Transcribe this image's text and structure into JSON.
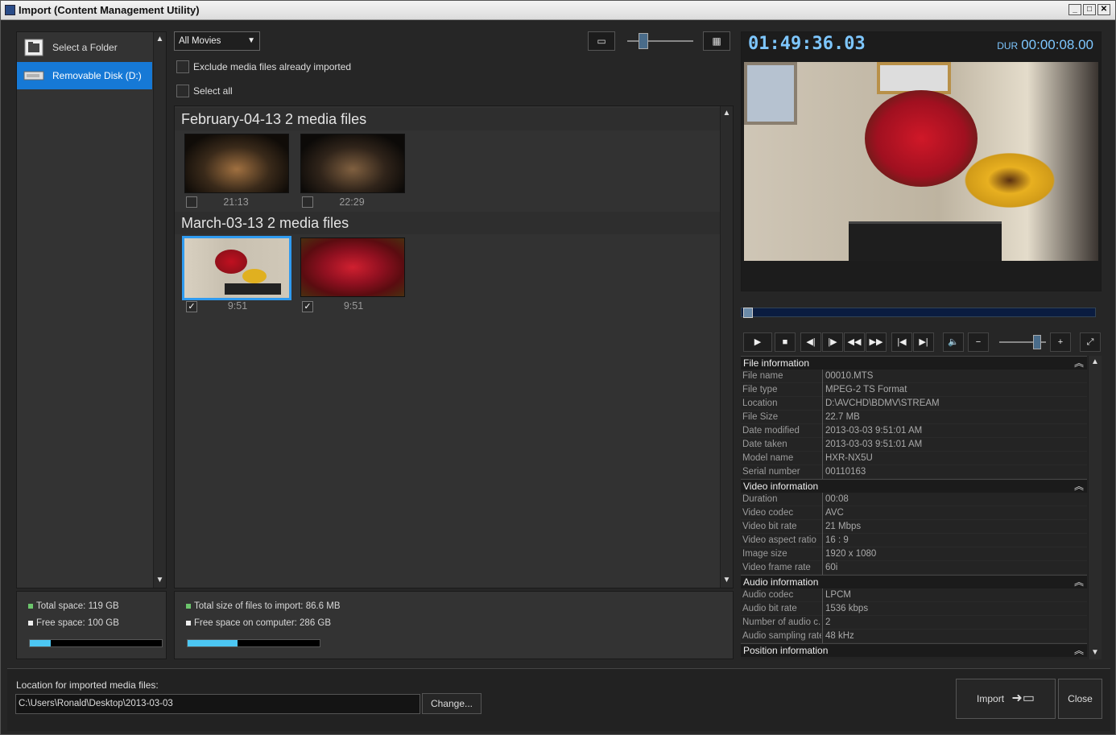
{
  "window": {
    "title": "Import (Content Management Utility)"
  },
  "sidebar": {
    "items": [
      {
        "label": "Select a Folder",
        "icon": "folder-icon"
      },
      {
        "label": "Removable Disk (D:)",
        "icon": "drive-icon"
      }
    ],
    "total_space": "Total space: 119 GB",
    "free_space": "Free space: 100 GB",
    "usage_fraction": 0.16
  },
  "browser": {
    "filter": "All Movies",
    "exclude_label": "Exclude media files already imported",
    "select_all_label": "Select all",
    "groups": [
      {
        "title": "February-04-13 2 media files",
        "items": [
          {
            "time": "21:13",
            "checked": false
          },
          {
            "time": "22:29",
            "checked": false
          }
        ]
      },
      {
        "title": "March-03-13 2 media files",
        "items": [
          {
            "time": "9:51",
            "checked": true
          },
          {
            "time": "9:51",
            "checked": true
          }
        ]
      }
    ],
    "total_import": "Total size of files to import: 86.6 MB",
    "free_computer": "Free space on computer: 286 GB",
    "usage_fraction": 0.38
  },
  "preview": {
    "timecode": "01:49:36.03",
    "dur_label": "DUR",
    "duration": "00:00:08.00"
  },
  "file_info": {
    "header": "File information",
    "rows": [
      {
        "k": "File name",
        "v": "00010.MTS"
      },
      {
        "k": "File type",
        "v": "MPEG-2 TS Format"
      },
      {
        "k": "Location",
        "v": "D:\\AVCHD\\BDMV\\STREAM"
      },
      {
        "k": "File Size",
        "v": "22.7 MB"
      },
      {
        "k": "Date modified",
        "v": "2013-03-03 9:51:01 AM"
      },
      {
        "k": "Date taken",
        "v": "2013-03-03 9:51:01 AM"
      },
      {
        "k": "Model name",
        "v": "HXR-NX5U"
      },
      {
        "k": "Serial number",
        "v": "00110163"
      }
    ]
  },
  "video_info": {
    "header": "Video information",
    "rows": [
      {
        "k": "Duration",
        "v": "00:08"
      },
      {
        "k": "Video codec",
        "v": "AVC"
      },
      {
        "k": "Video bit rate",
        "v": "21 Mbps"
      },
      {
        "k": "Video aspect ratio",
        "v": "16 : 9"
      },
      {
        "k": "Image size",
        "v": "1920 x 1080"
      },
      {
        "k": "Video frame rate",
        "v": "60i"
      }
    ]
  },
  "audio_info": {
    "header": "Audio information",
    "rows": [
      {
        "k": "Audio codec",
        "v": "LPCM"
      },
      {
        "k": "Audio bit rate",
        "v": "1536 kbps"
      },
      {
        "k": "Number of audio c...",
        "v": "2"
      },
      {
        "k": "Audio sampling rate",
        "v": "48 kHz"
      }
    ]
  },
  "position_info": {
    "header": "Position information"
  },
  "bottom": {
    "location_label": "Location for imported media files:",
    "location_value": "C:\\Users\\Ronald\\Desktop\\2013-03-03",
    "change_label": "Change...",
    "import_label": "Import",
    "close_label": "Close"
  }
}
